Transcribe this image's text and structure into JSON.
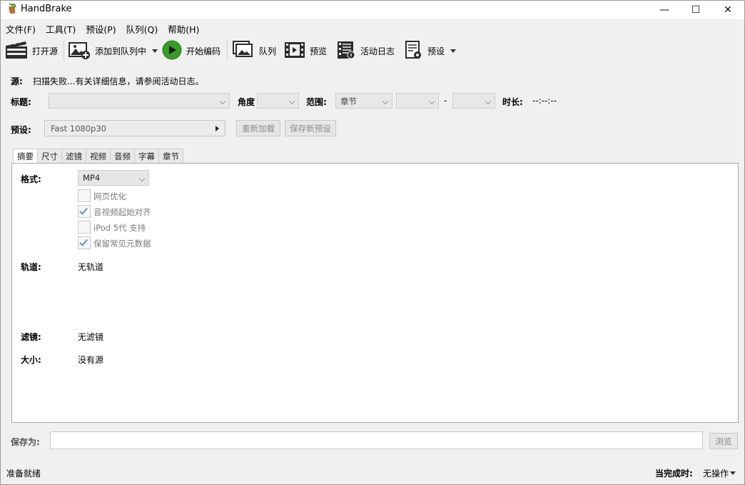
{
  "window": {
    "title": "HandBrake",
    "controls": {
      "minimize": "—",
      "maximize": "☐",
      "close": "✕"
    }
  },
  "menu": {
    "items": [
      "文件(F)",
      "工具(T)",
      "预设(P)",
      "队列(Q)",
      "帮助(H)"
    ]
  },
  "toolbar": {
    "open_source": "打开源",
    "add_to_queue": "添加到队列中",
    "start_encode": "开始编码",
    "queue": "队列",
    "preview": "预览",
    "activity_log": "活动日志",
    "presets": "预设"
  },
  "source": {
    "label": "源:",
    "value": "扫描失败...有关详细信息，请参阅活动日志。"
  },
  "title_row": {
    "title_label": "标题:",
    "angle_label": "角度",
    "range_label": "范围:",
    "range_type": "章节",
    "range_dash": "-",
    "duration_label": "时长:",
    "duration_value": "--:--:--"
  },
  "preset_row": {
    "label": "预设:",
    "value": "Fast 1080p30",
    "reload_button": "重新加载",
    "save_new_button": "保存新预设"
  },
  "tabs": [
    "摘要",
    "尺寸",
    "滤镜",
    "视频",
    "音频",
    "字幕",
    "章节"
  ],
  "summary": {
    "format_label": "格式:",
    "format_value": "MP4",
    "options": [
      {
        "label": "网页优化",
        "checked": false
      },
      {
        "label": "音视频起始对齐",
        "checked": true
      },
      {
        "label": "iPod 5代 支持",
        "checked": false
      },
      {
        "label": "保留常见元数据",
        "checked": true
      }
    ],
    "tracks_label": "轨道:",
    "tracks_value": "无轨道",
    "filters_label": "滤镜:",
    "filters_value": "无滤镜",
    "size_label": "大小:",
    "size_value": "没有源"
  },
  "save_as": {
    "label": "保存为:",
    "value": "",
    "browse_button": "浏览"
  },
  "status": {
    "text": "准备就绪",
    "when_done_label": "当完成时:",
    "when_done_value": "无操作"
  },
  "colors": {
    "window_bg": "#f0f0f0",
    "panel_bg": "#ffffff",
    "check_blue": "#5b92c8",
    "play_green": "#3a9a2a"
  }
}
